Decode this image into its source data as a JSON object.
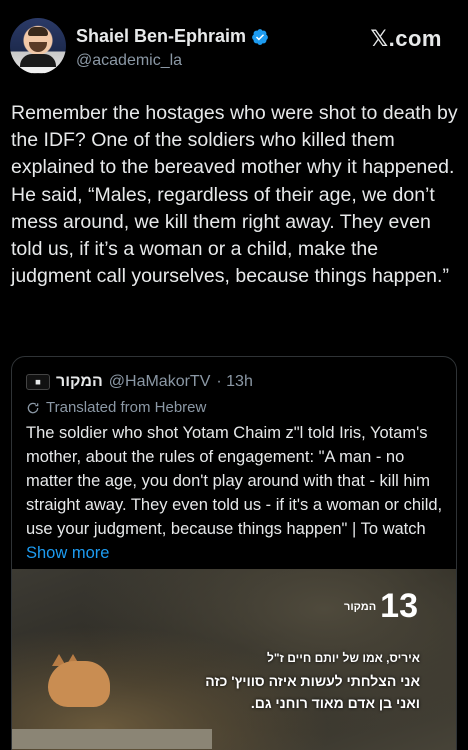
{
  "author": {
    "name": "Shaiel Ben-Ephraim",
    "handle": "@academic_la",
    "verified": true,
    "verified_color": "#1d9bf0"
  },
  "brand": {
    "label": "𝕏.com"
  },
  "tweet": {
    "text": "Remember the hostages who were shot to death by the IDF? One of the soldiers who killed them explained to the bereaved mother why it happened. He said, “Males, regardless of their age, we don’t mess around, we kill them right away. They even told us, if it’s a woman or a child, make the judgment call yourselves, because things happen.”"
  },
  "quote": {
    "name": "המקור",
    "handle": "@HaMakorTV",
    "time": "· 13h",
    "translated_label": "Translated from Hebrew",
    "text": "The soldier who shot Yotam Chaim z\"l told Iris, Yotam's mother, about the rules of engagement: \"A man - no matter the age, you don't play around with that - kill him straight away. They even told us - if it's a woman or child, use your judgment, because things happen\" | To watch ",
    "show_more": "Show more",
    "media": {
      "channel_number": "13",
      "channel_label": "המקור",
      "caption_line1": "איריס, אמו של יותם חיים ז\"ל",
      "caption_line2": "אני הצלחתי לעשות איזה סוויץ' כזה",
      "caption_line3": "ואני בן אדם מאוד רוחני גם."
    }
  },
  "icons": {
    "verified": "verified-badge-icon",
    "translate": "translate-icon",
    "source_logo": "hamakor-logo-icon"
  },
  "colors": {
    "background": "#000000",
    "text": "#e7e9ea",
    "muted": "#8b98a5",
    "link": "#1d9bf0",
    "border": "#2f3336"
  }
}
